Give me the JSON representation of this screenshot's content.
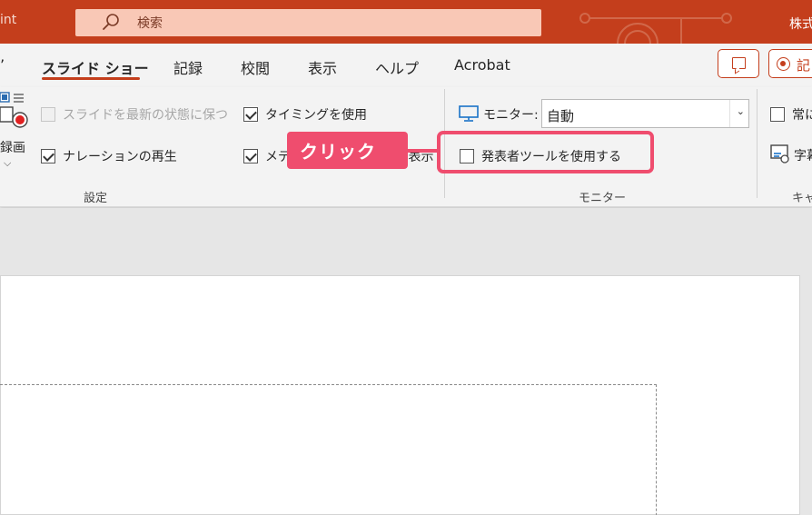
{
  "titlebar": {
    "app_name": "int",
    "search_placeholder": "検索",
    "account": "株式"
  },
  "tabs": [
    {
      "label": "スライド ショー",
      "active": true
    },
    {
      "label": "記録"
    },
    {
      "label": "校閲"
    },
    {
      "label": "表示"
    },
    {
      "label": "ヘルプ"
    },
    {
      "label": "Acrobat"
    }
  ],
  "toolbar": {
    "record_label": "記"
  },
  "ribbon": {
    "record": {
      "label": "録画"
    },
    "setup": {
      "keep_updated": {
        "label": "スライドを最新の状態に保つ",
        "checked": false,
        "disabled": true
      },
      "use_timings": {
        "label": "タイミングを使用",
        "checked": true
      },
      "play_narrations": {
        "label": "ナレーションの再生",
        "checked": true
      },
      "show_media_controls": {
        "label": "メディア コントロールの表示",
        "checked": true
      },
      "group_label": "設定"
    },
    "monitors": {
      "monitor_label": "モニター:",
      "monitor_value": "自動",
      "presenter_view": {
        "label": "発表者ツールを使用する",
        "checked": false
      },
      "group_label": "モニター"
    },
    "captions": {
      "always_use_subtitles": {
        "label": "常に",
        "checked": false
      },
      "subtitle_settings": {
        "label": "字幕"
      },
      "group_label": "キャ"
    }
  },
  "annotation": {
    "callout": "クリック",
    "color": "#ef4d6e"
  },
  "colors": {
    "accent": "#c43e1c",
    "ribbon_bg": "#f3f3f3"
  }
}
